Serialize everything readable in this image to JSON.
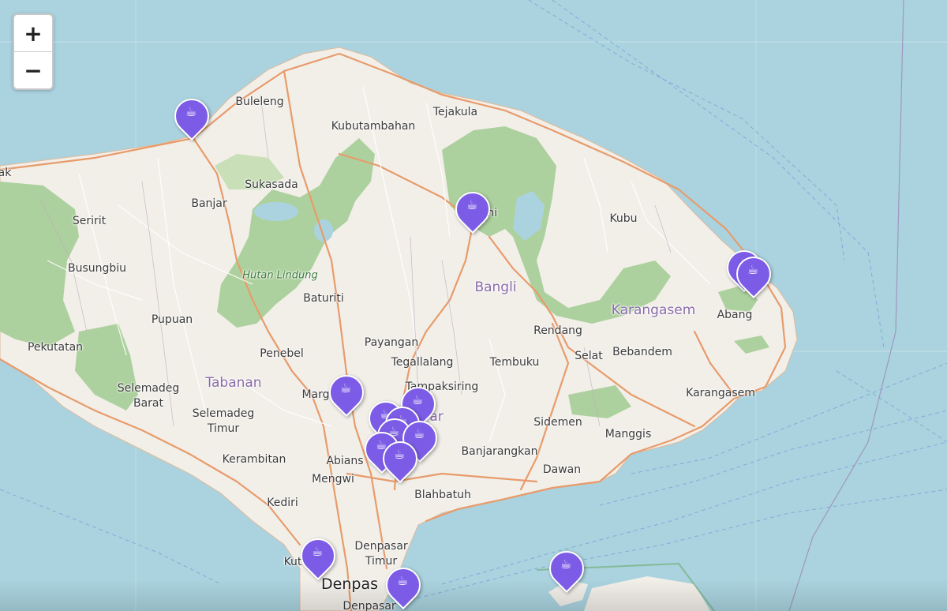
{
  "zoom": {
    "in_label": "+",
    "out_label": "−"
  },
  "colors": {
    "sea": "#aad3df",
    "land": "#f2efe9",
    "forest": "#add19e",
    "road": "#e89b6b",
    "marker": "#7c5ce6"
  },
  "marker_icon": "coffee-cup-icon",
  "marker_glyph": "☕",
  "labels": {
    "buleleng": "Buleleng",
    "kubutambahan": "Kubutambahan",
    "tejakula": "Tejakula",
    "sukasada": "Sukasada",
    "banjar": "Banjar",
    "seririt": "Seririt",
    "busungbiu": "Busungbiu",
    "hutan_lindung": "Hutan Lindung",
    "baturiti": "Baturiti",
    "pupuan": "Pupuan",
    "pekutatan": "Pekutatan",
    "penebel": "Penebel",
    "tabanan": "Tabanan",
    "selemadeg_barat": "Selemadeg\nBarat",
    "selemadeg_timur": "Selemadeg\nTimur",
    "kerambitan": "Kerambitan",
    "kediri": "Kediri",
    "mengwi": "Mengwi",
    "abiansemal": "Abians",
    "marga": "Marg",
    "payangan": "Payangan",
    "tegallalang": "Tegallalang",
    "tampaksiring": "Tampaksiring",
    "gianyar": "yar",
    "bangli": "Bangli",
    "kintamani": "K    ani",
    "tembuku": "Tembuku",
    "rendang": "Rendang",
    "karangasem_region": "Karangasem",
    "kubu": "Kubu",
    "abang": "Abang",
    "selat": "Selat",
    "bebandem": "Bebandem",
    "karangasem": "Karangasem",
    "sidemen": "Sidemen",
    "manggis": "Manggis",
    "banjarangkan": "Banjarangkan",
    "dawan": "Dawan",
    "blahbatuh": "Blahbatuh",
    "denpasar_timur": "Denpasar\nTimur",
    "kuta": "Kut",
    "denpasar": "Denpas",
    "denpasar_small": "Denpasar",
    "ak": "ak"
  }
}
